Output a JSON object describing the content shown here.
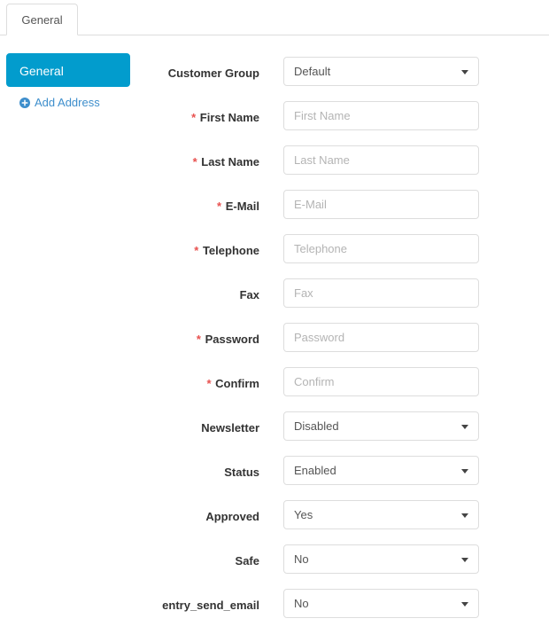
{
  "tabs": [
    {
      "label": "General",
      "active": true
    }
  ],
  "sidebar": {
    "nav_button_label": "General",
    "add_address_label": "Add Address",
    "add_icon": "plus-circle-icon"
  },
  "colors": {
    "accent_button": "#029ccd",
    "link": "#3d8ecc",
    "required_asterisk": "#e8514f",
    "border": "#dddddd",
    "label_text": "#333333",
    "placeholder_text": "#b4b4b4"
  },
  "form": {
    "fields": [
      {
        "label": "Customer Group",
        "required": false,
        "type": "select",
        "value": "Default",
        "icon": "chevron-down-icon"
      },
      {
        "label": "First Name",
        "required": true,
        "type": "text",
        "value": "",
        "placeholder": "First Name"
      },
      {
        "label": "Last Name",
        "required": true,
        "type": "text",
        "value": "",
        "placeholder": "Last Name"
      },
      {
        "label": "E-Mail",
        "required": true,
        "type": "text",
        "value": "",
        "placeholder": "E-Mail"
      },
      {
        "label": "Telephone",
        "required": true,
        "type": "text",
        "value": "",
        "placeholder": "Telephone"
      },
      {
        "label": "Fax",
        "required": false,
        "type": "text",
        "value": "",
        "placeholder": "Fax"
      },
      {
        "label": "Password",
        "required": true,
        "type": "password",
        "value": "",
        "placeholder": "Password"
      },
      {
        "label": "Confirm",
        "required": true,
        "type": "password",
        "value": "",
        "placeholder": "Confirm"
      },
      {
        "label": "Newsletter",
        "required": false,
        "type": "select",
        "value": "Disabled",
        "icon": "chevron-down-icon"
      },
      {
        "label": "Status",
        "required": false,
        "type": "select",
        "value": "Enabled",
        "icon": "chevron-down-icon"
      },
      {
        "label": "Approved",
        "required": false,
        "type": "select",
        "value": "Yes",
        "icon": "chevron-down-icon"
      },
      {
        "label": "Safe",
        "required": false,
        "type": "select",
        "value": "No",
        "icon": "chevron-down-icon"
      },
      {
        "label": "entry_send_email",
        "required": false,
        "type": "select",
        "value": "No",
        "icon": "chevron-down-icon"
      }
    ]
  }
}
